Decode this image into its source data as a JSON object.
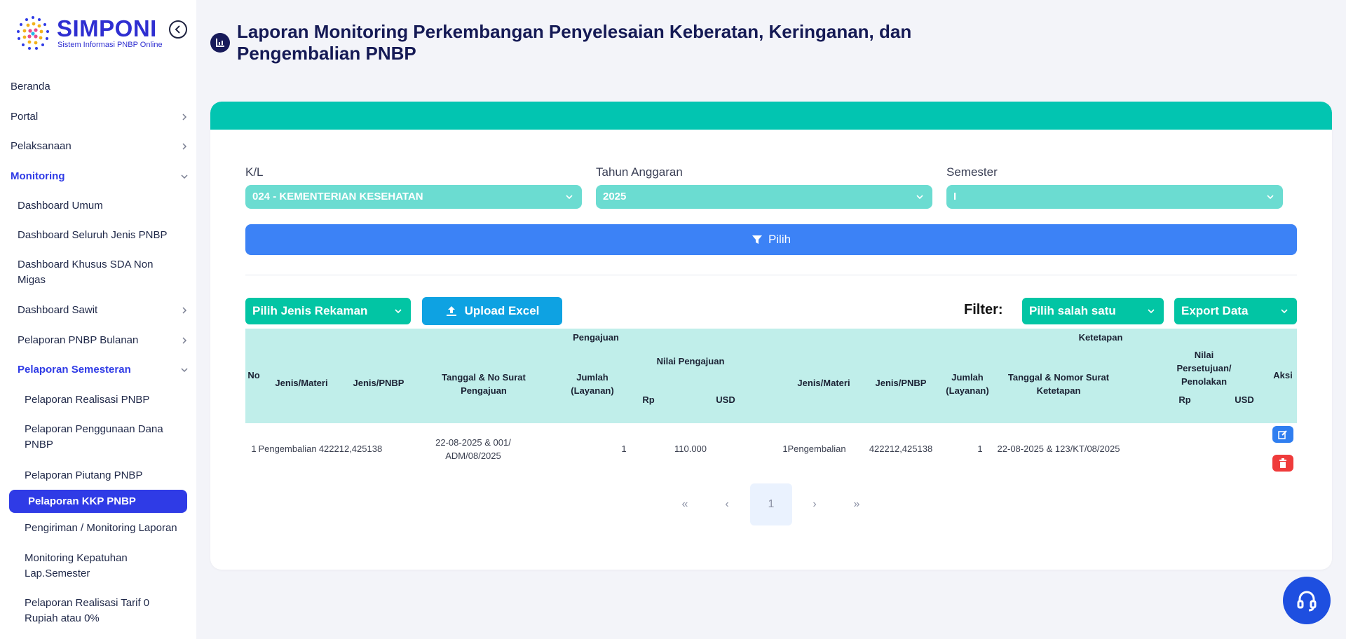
{
  "brand": {
    "title": "SIMPONI",
    "subtitle": "Sistem Informasi PNBP Online",
    "colors": {
      "primary": "#2f3be6",
      "teal": "#02c5b1",
      "blue": "#3c82f6",
      "danger": "#ef3b3b"
    }
  },
  "sidebar": {
    "items": [
      {
        "label": "Beranda"
      },
      {
        "label": "Portal",
        "chevron": "right"
      },
      {
        "label": "Pelaksanaan",
        "chevron": "right"
      },
      {
        "label": "Monitoring",
        "chevron": "down"
      },
      {
        "label": "Dashboard Umum"
      },
      {
        "label": "Dashboard Seluruh Jenis PNBP"
      },
      {
        "label": "Dashboard Khusus SDA Non Migas"
      },
      {
        "label": "Dashboard Sawit",
        "chevron": "right"
      },
      {
        "label": "Pelaporan PNBP Bulanan",
        "chevron": "right"
      },
      {
        "label": "Pelaporan Semesteran",
        "chevron": "down"
      },
      {
        "label": "Pelaporan Realisasi PNBP"
      },
      {
        "label": "Pelaporan Penggunaan Dana PNBP"
      },
      {
        "label": "Pelaporan Piutang PNBP"
      },
      {
        "label": "Pelaporan KKP PNBP"
      },
      {
        "label": "Pengiriman / Monitoring Laporan"
      },
      {
        "label": "Monitoring Kepatuhan Lap.Semester"
      },
      {
        "label": "Pelaporan Realisasi Tarif 0 Rupiah atau 0%"
      }
    ]
  },
  "header": {
    "icon": "report-chart-icon",
    "title": "Laporan Monitoring Perkembangan Penyelesaian Keberatan, Keringanan, dan Pengembalian PNBP"
  },
  "filters": {
    "kl_label": "K/L",
    "kl_value": "024 - KEMENTERIAN KESEHATAN",
    "tahun_label": "Tahun Anggaran",
    "tahun_value": "2025",
    "semester_label": "Semester",
    "semester_value": "I",
    "pilih_label": "Pilih"
  },
  "toolbar": {
    "jenis_rekaman": "Pilih Jenis Rekaman",
    "upload": "Upload Excel",
    "filter_label": "Filter:",
    "filter_value": "Pilih salah satu",
    "export": "Export Data"
  },
  "table": {
    "headers": {
      "no": "No",
      "pengajuan": "Pengajuan",
      "ketetapan": "Ketetapan",
      "jenis_materi_1": "Jenis/Materi",
      "jenis_pnbp_1": "Jenis/PNBP",
      "tanggal_pengajuan": "Tanggal & No Surat Pengajuan",
      "jumlah_1": "Jumlah (Layanan)",
      "nilai_pengajuan": "Nilai Pengajuan",
      "rp_1": "Rp",
      "usd_1": "USD",
      "jenis_materi_2": "Jenis/Materi",
      "jenis_pnbp_2": "Jenis/PNBP",
      "jumlah_2": "Jumlah (Layanan)",
      "tanggal_ketetapan": "Tanggal & Nomor Surat Ketetapan",
      "nilai_persetujuan": "Nilai Persetujuan/ Penolakan",
      "rp_2": "Rp",
      "usd_2": "USD",
      "aksi": "Aksi"
    },
    "rows": [
      {
        "no": "1",
        "jenis_materi": "Pengembalian",
        "jenis_pnbp": "422212,425138",
        "tanggal_pengajuan": "22-08-2025 & 001/ ADM/08/2025",
        "jumlah": "1",
        "rp": "110.000",
        "usd": "",
        "no_k": "1",
        "jenis_materi_k": "Pengembalian",
        "jenis_pnbp_k": "422212,425138",
        "jumlah_k": "1",
        "tanggal_ketetapan": "22-08-2025 & 123/KT/08/2025",
        "rp_k": "",
        "usd_k": ""
      }
    ]
  },
  "pagination": {
    "first": "«",
    "prev": "‹",
    "current": "1",
    "next": "›",
    "last": "»"
  }
}
